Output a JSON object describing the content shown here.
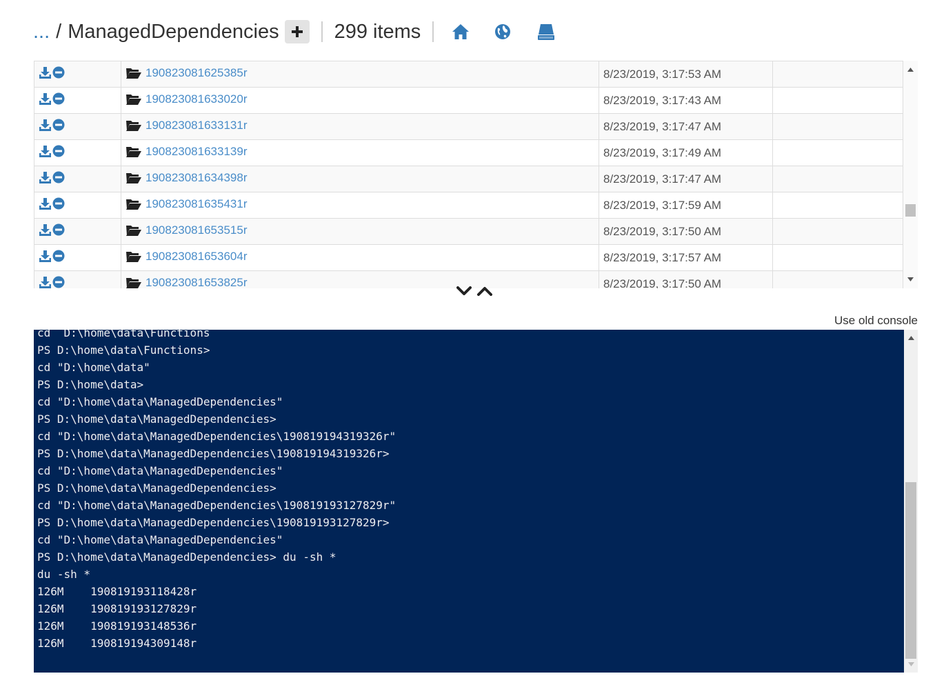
{
  "header": {
    "ellipsis": "...",
    "separator": "/",
    "current_folder": "ManagedDependencies",
    "items_count": "299 items",
    "icons": [
      "plus-icon",
      "home-icon",
      "globe-icon",
      "drive-icon"
    ]
  },
  "files": [
    {
      "name": "190823081625385r",
      "date": "8/23/2019, 3:17:53 AM",
      "size": ""
    },
    {
      "name": "190823081633020r",
      "date": "8/23/2019, 3:17:43 AM",
      "size": ""
    },
    {
      "name": "190823081633131r",
      "date": "8/23/2019, 3:17:47 AM",
      "size": ""
    },
    {
      "name": "190823081633139r",
      "date": "8/23/2019, 3:17:49 AM",
      "size": ""
    },
    {
      "name": "190823081634398r",
      "date": "8/23/2019, 3:17:47 AM",
      "size": ""
    },
    {
      "name": "190823081635431r",
      "date": "8/23/2019, 3:17:59 AM",
      "size": ""
    },
    {
      "name": "190823081653515r",
      "date": "8/23/2019, 3:17:50 AM",
      "size": ""
    },
    {
      "name": "190823081653604r",
      "date": "8/23/2019, 3:17:57 AM",
      "size": ""
    },
    {
      "name": "190823081653825r",
      "date": "8/23/2019, 3:17:50 AM",
      "size": ""
    }
  ],
  "row_icons": [
    "download-icon",
    "remove-icon",
    "folder-open-icon"
  ],
  "splitter": {
    "icons": [
      "chevron-down-icon",
      "chevron-up-icon"
    ]
  },
  "console": {
    "old_console_link": "Use old console",
    "lines": [
      "cd  D:\\home\\data\\Functions",
      "PS D:\\home\\data\\Functions>",
      "cd \"D:\\home\\data\"",
      "PS D:\\home\\data>",
      "cd \"D:\\home\\data\\ManagedDependencies\"",
      "PS D:\\home\\data\\ManagedDependencies>",
      "cd \"D:\\home\\data\\ManagedDependencies\\190819194319326r\"",
      "PS D:\\home\\data\\ManagedDependencies\\190819194319326r>",
      "cd \"D:\\home\\data\\ManagedDependencies\"",
      "PS D:\\home\\data\\ManagedDependencies>",
      "cd \"D:\\home\\data\\ManagedDependencies\\190819193127829r\"",
      "PS D:\\home\\data\\ManagedDependencies\\190819193127829r>",
      "cd \"D:\\home\\data\\ManagedDependencies\"",
      "PS D:\\home\\data\\ManagedDependencies> du -sh *",
      "du -sh *",
      "126M    190819193118428r",
      "126M    190819193127829r",
      "126M    190819193148536r",
      "126M    190819194309148r"
    ]
  },
  "colors": {
    "link": "#337ab7",
    "folder_link": "#4a8dc9",
    "console_bg": "#012456",
    "console_text": "#eeedf0"
  }
}
